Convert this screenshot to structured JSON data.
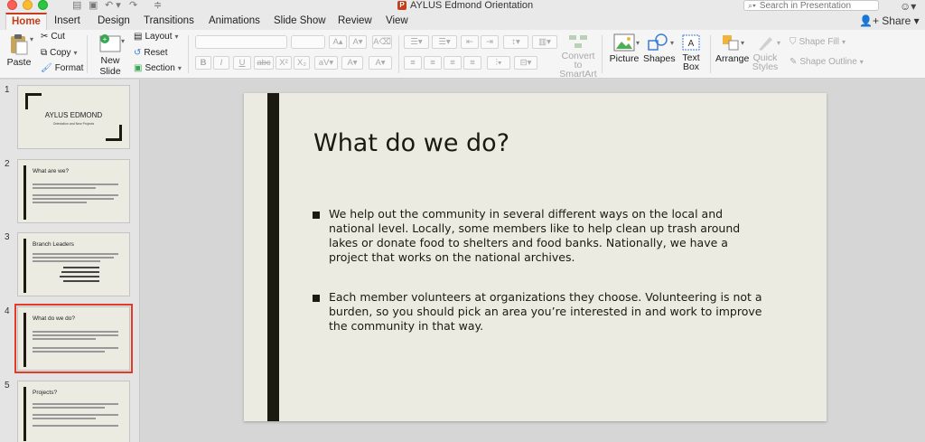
{
  "app": {
    "doc_title": "AYLUS Edmond Orientation",
    "search_placeholder": "Search in Presentation",
    "share_label": "Share"
  },
  "tabs": [
    "Home",
    "Insert",
    "Design",
    "Transitions",
    "Animations",
    "Slide Show",
    "Review",
    "View"
  ],
  "ribbon": {
    "paste": "Paste",
    "cut": "Cut",
    "copy": "Copy",
    "format": "Format",
    "new_slide_1": "New",
    "new_slide_2": "Slide",
    "layout": "Layout",
    "reset": "Reset",
    "section": "Section",
    "convert_1": "Convert to",
    "convert_2": "SmartArt",
    "picture": "Picture",
    "shapes": "Shapes",
    "text_box_1": "Text",
    "text_box_2": "Box",
    "arrange": "Arrange",
    "quick_styles_1": "Quick",
    "quick_styles_2": "Styles",
    "shape_fill": "Shape Fill",
    "shape_outline": "Shape Outline"
  },
  "thumbnails": [
    {
      "num": "1",
      "title": "AYLUS EDMOND",
      "subtitle": "Orientation and New Projects"
    },
    {
      "num": "2",
      "title": "What are we?"
    },
    {
      "num": "3",
      "title": "Branch Leaders"
    },
    {
      "num": "4",
      "title": "What do we do?"
    },
    {
      "num": "5",
      "title": "Projects?"
    }
  ],
  "slide": {
    "title": "What do we do?",
    "bullets": [
      "We help out the community in several different ways on the local and national level. Locally, some members like to help clean up trash around lakes or donate food to shelters and food banks. Nationally, we have a project that works on the national archives.",
      "Each member volunteers at organizations they choose. Volunteering is not a burden, so you should pick an area you’re interested in and work to improve the community in that way."
    ]
  },
  "colors": {
    "accent": "#c43e1c",
    "slide_bg": "#ebebe1",
    "slide_bar": "#1a1a10",
    "selection": "#e23b27"
  }
}
